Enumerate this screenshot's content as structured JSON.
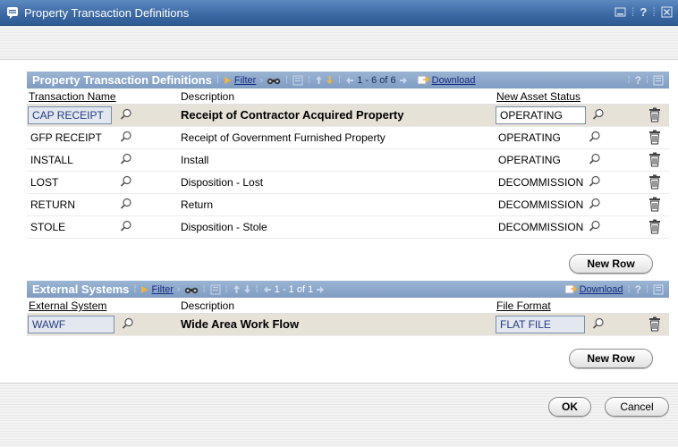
{
  "window": {
    "title": "Property Transaction Definitions"
  },
  "grid1": {
    "title": "Property Transaction Definitions",
    "filter_label": "Filter",
    "pagination": "1 - 6 of 6",
    "download_label": "Download",
    "help_label": "?",
    "columns": {
      "name": "Transaction Name",
      "description": "Description",
      "status": "New Asset Status"
    },
    "rows": [
      {
        "name": "CAP RECEIPT",
        "description": "Receipt of Contractor Acquired Property",
        "status": "OPERATING"
      },
      {
        "name": "GFP RECEIPT",
        "description": "Receipt of Government Furnished Property",
        "status": "OPERATING"
      },
      {
        "name": "INSTALL",
        "description": "Install",
        "status": "OPERATING"
      },
      {
        "name": "LOST",
        "description": "Disposition - Lost",
        "status": "DECOMMISSION"
      },
      {
        "name": "RETURN",
        "description": "Return",
        "status": "DECOMMISSION"
      },
      {
        "name": "STOLE",
        "description": "Disposition - Stole",
        "status": "DECOMMISSION"
      }
    ],
    "new_row_label": "New Row"
  },
  "grid2": {
    "title": "External Systems",
    "filter_label": "Filter",
    "pagination": "1 - 1 of 1",
    "download_label": "Download",
    "help_label": "?",
    "columns": {
      "system": "External System",
      "description": "Description",
      "format": "File Format"
    },
    "rows": [
      {
        "system": "WAWF",
        "description": "Wide Area Work Flow",
        "format": "FLAT FILE"
      }
    ],
    "new_row_label": "New Row"
  },
  "footer": {
    "ok_label": "OK",
    "cancel_label": "Cancel"
  },
  "colors": {
    "title_bar": "#3d6aa4",
    "grid_header": "#8aa6ca",
    "selected_row": "#e6e2d8",
    "link": "#1a2e80"
  },
  "icons": [
    "window-icon",
    "minimize-icon",
    "help-icon",
    "close-icon",
    "filter-icon",
    "find-icon",
    "view-all-icon",
    "sort-up-icon",
    "sort-down-icon",
    "prev-icon",
    "next-icon",
    "download-icon",
    "personalize-icon",
    "lookup-icon",
    "delete-icon"
  ]
}
